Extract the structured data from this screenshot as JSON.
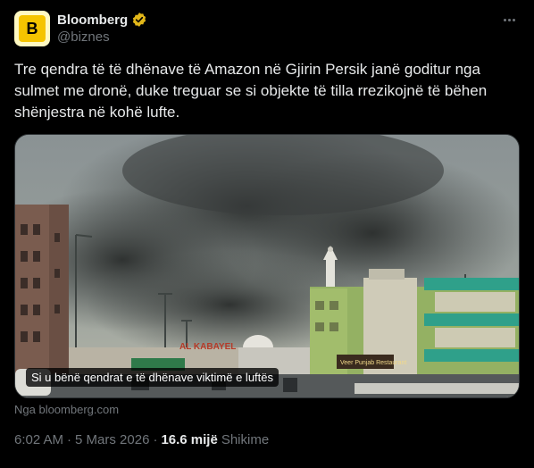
{
  "author": {
    "display_name": "Bloomberg",
    "handle": "@biznes",
    "avatar_letter": "B",
    "avatar_color": "#f5c400",
    "verified_badge_color": "#e2b719"
  },
  "post": {
    "text": "Tre qendra të të dhënave të Amazon në Gjirin Persik janë goditur nga sulmet me dronë, duke treguar se si objekte të tilla rrezikojnë të bëhen shënjestra në kohë lufte.",
    "media": {
      "caption": "Si u bënë qendrat e të dhënave viktimë e luftës",
      "signs": {
        "left": "AL KABAYEL",
        "right": "Veer Punjab Restaurant"
      }
    },
    "link_source": "Nga bloomberg.com",
    "time": "6:02 AM",
    "date": "5 Mars 2026",
    "separator_1": "·",
    "separator_2": "·",
    "views_count": "16.6 mijë",
    "views_label": "Shikime"
  },
  "colors": {
    "background": "#000000",
    "text": "#e7e9ea",
    "muted": "#71767b",
    "border": "#2f3336"
  }
}
